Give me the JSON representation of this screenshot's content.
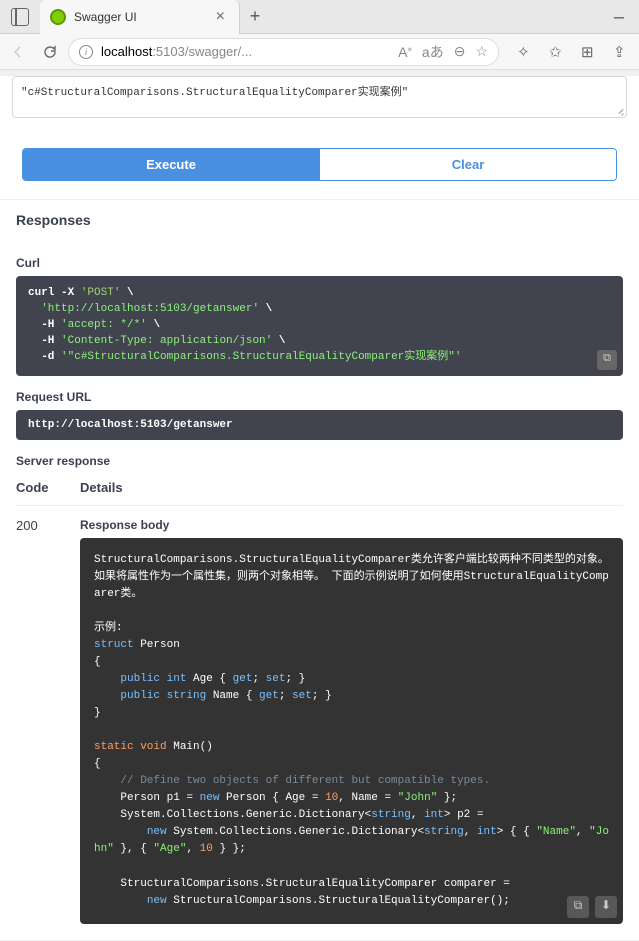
{
  "window": {
    "tab_title": "Swagger UI",
    "url_host": "localhost",
    "url_port": ":5103",
    "url_path": "/swagger/..."
  },
  "input": {
    "value": "\"c#StructuralComparisons.StructuralEqualityComparer实现案例\""
  },
  "buttons": {
    "execute": "Execute",
    "clear": "Clear"
  },
  "labels": {
    "responses": "Responses",
    "curl": "Curl",
    "request_url": "Request URL",
    "server_response": "Server response",
    "code": "Code",
    "details": "Details",
    "response_body": "Response body"
  },
  "curl": {
    "line1a": "curl -X ",
    "line1_method": "'POST'",
    "line1_back": " \\",
    "line2_url": "'http://localhost:5103/getanswer'",
    "line2_back": " \\",
    "line3_flag": "-H ",
    "line3_val": "'accept: */*'",
    "line3_back": " \\",
    "line4_flag": "-H ",
    "line4_val": "'Content-Type: application/json'",
    "line4_back": " \\",
    "line5_flag": "-d ",
    "line5_val": "'\"c#StructuralComparisons.StructuralEqualityComparer实现案例\"'"
  },
  "request_url": "http://localhost:5103/getanswer",
  "status_code": "200",
  "response_body": {
    "p1": "StructuralComparisons.StructuralEqualityComparer类允许客户端比较两种不同类型的对象。如果将属性作为一个属性集，则两个对象相等。 下面的示例说明了如何使用StructuralEqualityComparer类。",
    "p2": "示例:",
    "p3": "struct Person",
    "p4": "{",
    "p5": "    public int Age { get; set; }",
    "p6": "    public string Name { get; set; }",
    "p7": "}",
    "p8": "",
    "p9": "static void Main()",
    "p10": "{",
    "p11": "    // Define two objects of different but compatible types.",
    "p12": "    Person p1 = new Person { Age = 10, Name = \"John\" };",
    "p13": "    System.Collections.Generic.Dictionary<string, int> p2 =",
    "p14": "        new System.Collections.Generic.Dictionary<string, int> { { \"Name\", \"John\" }, { \"Age\", 10 } };",
    "p15": "",
    "p16": "    StructuralComparisons.StructuralEqualityComparer comparer =",
    "p17": "        new StructuralComparisons.StructuralEqualityComparer();",
    "p18": ""
  }
}
